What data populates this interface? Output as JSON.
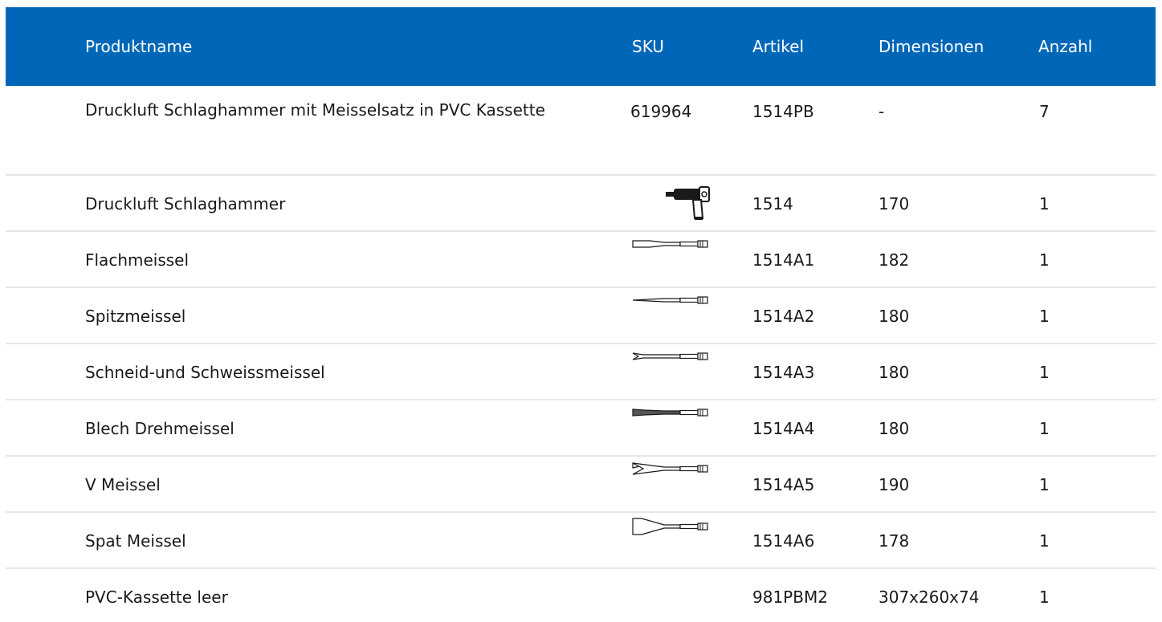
{
  "header": {
    "name": "Produktname",
    "sku": "SKU",
    "article": "Artikel",
    "dimensions": "Dimensionen",
    "quantity": "Anzahl"
  },
  "rows": [
    {
      "name": "Druckluft Schlaghammer mit Meisselsatz in PVC Kassette",
      "sku": "619964",
      "icon": "",
      "article": "1514PB",
      "dimensions": "-",
      "quantity": "7"
    },
    {
      "name": "Druckluft Schlaghammer",
      "sku": "",
      "icon": "air-hammer-icon",
      "article": "1514",
      "dimensions": "170",
      "quantity": "1"
    },
    {
      "name": "Flachmeissel",
      "sku": "",
      "icon": "flat-chisel-icon",
      "article": "1514A1",
      "dimensions": "182",
      "quantity": "1"
    },
    {
      "name": "Spitzmeissel",
      "sku": "",
      "icon": "point-chisel-icon",
      "article": "1514A2",
      "dimensions": "180",
      "quantity": "1"
    },
    {
      "name": "Schneid-und Schweissmeissel",
      "sku": "",
      "icon": "cutting-chisel-icon",
      "article": "1514A3",
      "dimensions": "180",
      "quantity": "1"
    },
    {
      "name": "Blech Drehmeissel",
      "sku": "",
      "icon": "panel-chisel-icon",
      "article": "1514A4",
      "dimensions": "180",
      "quantity": "1"
    },
    {
      "name": "V Meissel",
      "sku": "",
      "icon": "v-chisel-icon",
      "article": "1514A5",
      "dimensions": "190",
      "quantity": "1"
    },
    {
      "name": "Spat Meissel",
      "sku": "",
      "icon": "spade-chisel-icon",
      "article": "1514A6",
      "dimensions": "178",
      "quantity": "1"
    },
    {
      "name": "PVC-Kassette leer",
      "sku": "",
      "icon": "",
      "article": "981PBM2",
      "dimensions": "307x260x74",
      "quantity": "1"
    }
  ],
  "colors": {
    "header_bg": "#0067b8",
    "header_text": "#ffffff",
    "divider": "#e6e6e6"
  }
}
